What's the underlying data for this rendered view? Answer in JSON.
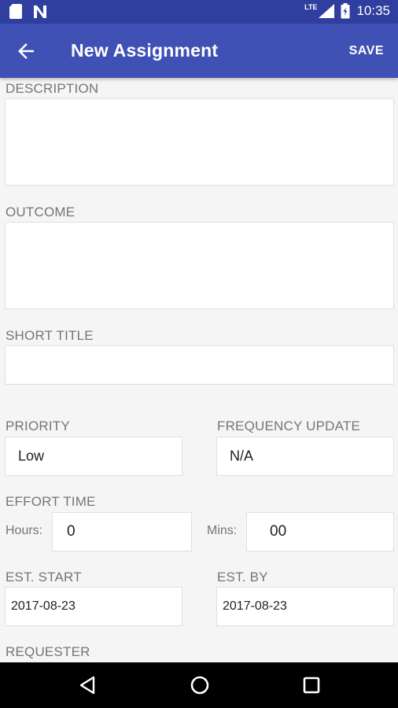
{
  "status_bar": {
    "network": "LTE",
    "time": "10:35",
    "left_icons": [
      "sd-card-icon",
      "notification-n-icon"
    ]
  },
  "app_bar": {
    "title": "New Assignment",
    "save_label": "SAVE",
    "background_color": "#3f51b5",
    "status_color": "#303f9f"
  },
  "form": {
    "description_label": "DESCRIPTION",
    "description_value": "",
    "outcome_label": "OUTCOME",
    "outcome_value": "",
    "short_title_label": "SHORT TITLE",
    "short_title_value": "",
    "priority_label": "PRIORITY",
    "priority_value": "Low",
    "frequency_label": "FREQUENCY UPDATE",
    "frequency_value": "N/A",
    "effort_label": "EFFORT TIME",
    "hours_label": "Hours:",
    "hours_value": "0",
    "mins_label": "Mins:",
    "mins_value": "00",
    "est_start_label": "EST. START",
    "est_start_value": "2017-08-23",
    "est_by_label": "EST. BY",
    "est_by_value": "2017-08-23",
    "requester_label": "REQUESTER"
  }
}
